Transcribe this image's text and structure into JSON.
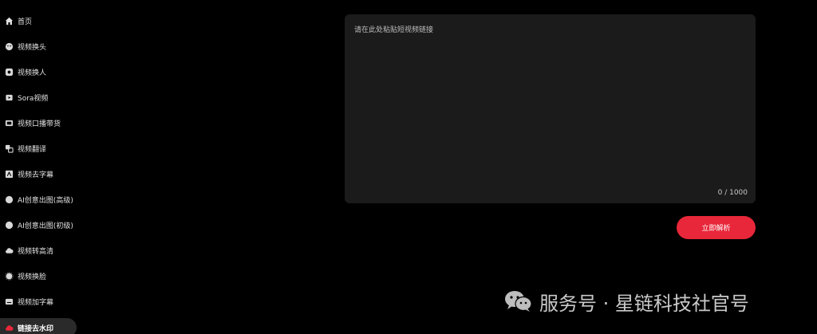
{
  "sidebar": {
    "items": [
      {
        "label": "首页",
        "icon": "home-icon"
      },
      {
        "label": "视频换头",
        "icon": "face-swap-icon"
      },
      {
        "label": "视频换人",
        "icon": "person-swap-icon"
      },
      {
        "label": "Sora视频",
        "icon": "sora-icon"
      },
      {
        "label": "视频口播带货",
        "icon": "broadcast-icon"
      },
      {
        "label": "视频翻译",
        "icon": "translate-icon"
      },
      {
        "label": "视频去字幕",
        "icon": "subtitle-remove-icon"
      },
      {
        "label": "AI创意出图(高级)",
        "icon": "ai-image-advanced-icon"
      },
      {
        "label": "AI创意出图(初级)",
        "icon": "ai-image-basic-icon"
      },
      {
        "label": "视频转高清",
        "icon": "cloud-hd-icon"
      },
      {
        "label": "视频换脸",
        "icon": "face-icon"
      },
      {
        "label": "视频加字幕",
        "icon": "subtitle-add-icon"
      },
      {
        "label": "链接去水印",
        "icon": "watermark-remove-icon",
        "active": true
      }
    ]
  },
  "main": {
    "input": {
      "placeholder": "请在此处粘贴短视频链接",
      "value": "",
      "counter": "0 / 1000"
    },
    "parse_button": "立即解析"
  },
  "watermark": {
    "text": "服务号 · 星链科技社官号"
  },
  "colors": {
    "background": "#000000",
    "panel": "#1b1b1b",
    "accent": "#e8273a",
    "active_item": "#2a2a2a"
  }
}
